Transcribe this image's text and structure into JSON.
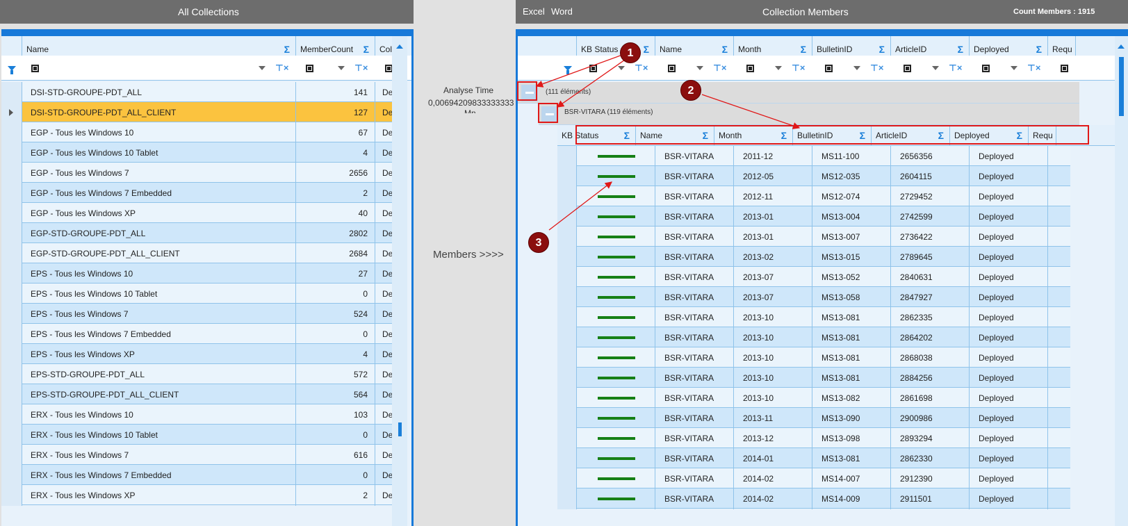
{
  "left_panel": {
    "title": "All Collections",
    "columns": [
      "Name",
      "MemberCount",
      "Coll"
    ],
    "rows": [
      {
        "name": "DSI-STD-GROUPE-PDT_ALL",
        "count": "141",
        "coll": "De"
      },
      {
        "name": "DSI-STD-GROUPE-PDT_ALL_CLIENT",
        "count": "127",
        "coll": "De"
      },
      {
        "name": "EGP - Tous les Windows 10",
        "count": "67",
        "coll": "De"
      },
      {
        "name": "EGP - Tous les Windows 10 Tablet",
        "count": "4",
        "coll": "De"
      },
      {
        "name": "EGP - Tous les Windows 7",
        "count": "2656",
        "coll": "De"
      },
      {
        "name": "EGP - Tous les Windows 7 Embedded",
        "count": "2",
        "coll": "De"
      },
      {
        "name": "EGP - Tous les Windows XP",
        "count": "40",
        "coll": "De"
      },
      {
        "name": "EGP-STD-GROUPE-PDT_ALL",
        "count": "2802",
        "coll": "De"
      },
      {
        "name": "EGP-STD-GROUPE-PDT_ALL_CLIENT",
        "count": "2684",
        "coll": "De"
      },
      {
        "name": "EPS - Tous les Windows 10",
        "count": "27",
        "coll": "De"
      },
      {
        "name": "EPS - Tous les Windows 10 Tablet",
        "count": "0",
        "coll": "De"
      },
      {
        "name": "EPS - Tous les Windows 7",
        "count": "524",
        "coll": "De"
      },
      {
        "name": "EPS - Tous les Windows 7 Embedded",
        "count": "0",
        "coll": "De"
      },
      {
        "name": "EPS - Tous les Windows XP",
        "count": "4",
        "coll": "De"
      },
      {
        "name": "EPS-STD-GROUPE-PDT_ALL",
        "count": "572",
        "coll": "De"
      },
      {
        "name": "EPS-STD-GROUPE-PDT_ALL_CLIENT",
        "count": "564",
        "coll": "De"
      },
      {
        "name": "ERX - Tous les Windows 10",
        "count": "103",
        "coll": "De"
      },
      {
        "name": "ERX - Tous les Windows 10 Tablet",
        "count": "0",
        "coll": "De"
      },
      {
        "name": "ERX - Tous les Windows 7",
        "count": "616",
        "coll": "De"
      },
      {
        "name": "ERX - Tous les Windows 7 Embedded",
        "count": "0",
        "coll": "De"
      },
      {
        "name": "ERX - Tous les Windows XP",
        "count": "2",
        "coll": "De"
      }
    ],
    "selected_index": 1
  },
  "middle": {
    "analyse_label": "Analyse Time",
    "analyse_value": "0,00694209833333333",
    "analyse_unit": "Mn",
    "members_button": "Members >>>>"
  },
  "right_panel": {
    "menu": [
      "Excel",
      "Word"
    ],
    "title": "Collection Members",
    "count_label": "Count Members : 1915",
    "columns": [
      "KB Status",
      "Name",
      "Month",
      "BulletinID",
      "ArticleID",
      "Deployed",
      "Requ"
    ],
    "group1_label": "(111 éléments)",
    "group2_label": "BSR-VITARA (119 éléments)",
    "rows": [
      {
        "name": "BSR-VITARA",
        "month": "2011-12",
        "bulletin": "MS11-100",
        "article": "2656356",
        "deployed": "Deployed"
      },
      {
        "name": "BSR-VITARA",
        "month": "2012-05",
        "bulletin": "MS12-035",
        "article": "2604115",
        "deployed": "Deployed"
      },
      {
        "name": "BSR-VITARA",
        "month": "2012-11",
        "bulletin": "MS12-074",
        "article": "2729452",
        "deployed": "Deployed"
      },
      {
        "name": "BSR-VITARA",
        "month": "2013-01",
        "bulletin": "MS13-004",
        "article": "2742599",
        "deployed": "Deployed"
      },
      {
        "name": "BSR-VITARA",
        "month": "2013-01",
        "bulletin": "MS13-007",
        "article": "2736422",
        "deployed": "Deployed"
      },
      {
        "name": "BSR-VITARA",
        "month": "2013-02",
        "bulletin": "MS13-015",
        "article": "2789645",
        "deployed": "Deployed"
      },
      {
        "name": "BSR-VITARA",
        "month": "2013-07",
        "bulletin": "MS13-052",
        "article": "2840631",
        "deployed": "Deployed"
      },
      {
        "name": "BSR-VITARA",
        "month": "2013-07",
        "bulletin": "MS13-058",
        "article": "2847927",
        "deployed": "Deployed"
      },
      {
        "name": "BSR-VITARA",
        "month": "2013-10",
        "bulletin": "MS13-081",
        "article": "2862335",
        "deployed": "Deployed"
      },
      {
        "name": "BSR-VITARA",
        "month": "2013-10",
        "bulletin": "MS13-081",
        "article": "2864202",
        "deployed": "Deployed"
      },
      {
        "name": "BSR-VITARA",
        "month": "2013-10",
        "bulletin": "MS13-081",
        "article": "2868038",
        "deployed": "Deployed"
      },
      {
        "name": "BSR-VITARA",
        "month": "2013-10",
        "bulletin": "MS13-081",
        "article": "2884256",
        "deployed": "Deployed"
      },
      {
        "name": "BSR-VITARA",
        "month": "2013-10",
        "bulletin": "MS13-082",
        "article": "2861698",
        "deployed": "Deployed"
      },
      {
        "name": "BSR-VITARA",
        "month": "2013-11",
        "bulletin": "MS13-090",
        "article": "2900986",
        "deployed": "Deployed"
      },
      {
        "name": "BSR-VITARA",
        "month": "2013-12",
        "bulletin": "MS13-098",
        "article": "2893294",
        "deployed": "Deployed"
      },
      {
        "name": "BSR-VITARA",
        "month": "2014-01",
        "bulletin": "MS13-081",
        "article": "2862330",
        "deployed": "Deployed"
      },
      {
        "name": "BSR-VITARA",
        "month": "2014-02",
        "bulletin": "MS14-007",
        "article": "2912390",
        "deployed": "Deployed"
      },
      {
        "name": "BSR-VITARA",
        "month": "2014-02",
        "bulletin": "MS14-009",
        "article": "2911501",
        "deployed": "Deployed"
      }
    ]
  },
  "annotations": {
    "badge1": "1",
    "badge2": "2",
    "badge3": "3"
  },
  "colors": {
    "header_bar": "#6d6d6d",
    "accent_blue": "#1779d9",
    "row_a": "#eaf4fc",
    "row_b": "#cfe7fa",
    "selected_row": "#fbc33f",
    "status_green": "#168016",
    "annotation_red": "#e01818",
    "badge_dark_red": "#8b0e0e"
  }
}
